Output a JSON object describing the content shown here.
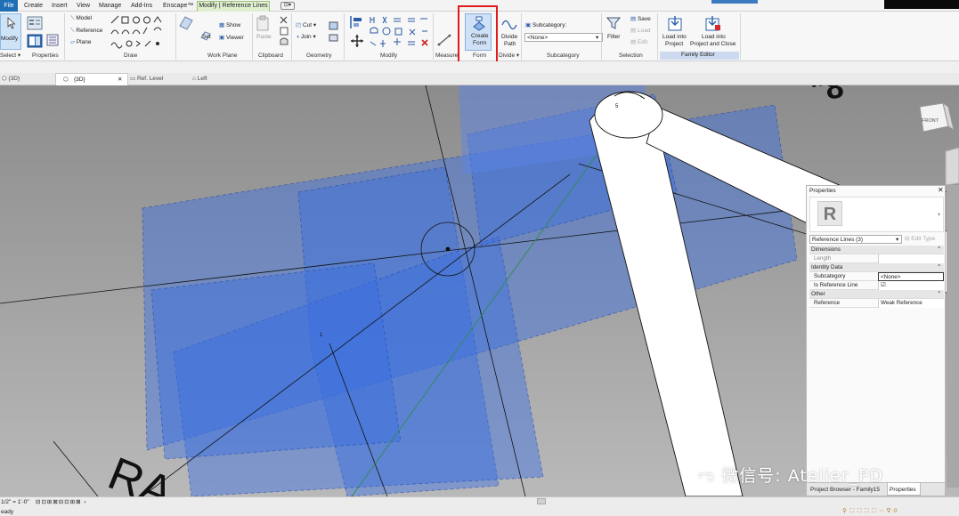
{
  "menubar": {
    "tabs": [
      "File",
      "Create",
      "Insert",
      "View",
      "Manage",
      "Add-Ins",
      "Enscape™",
      "Modify | Reference Lines"
    ]
  },
  "ribbon": {
    "select_label": "Select ▾",
    "properties_label": "Properties",
    "draw_label": "Draw",
    "draw_items": [
      "Model",
      "Reference",
      "Plane"
    ],
    "modify_big": "Modify",
    "workplane_label": "Work Plane",
    "workplane_items": {
      "set": "Set",
      "show": "Show",
      "viewer": "Viewer"
    },
    "clipboard_label": "Clipboard",
    "paste_label": "Paste",
    "geometry_label": "Geometry",
    "geometry_items": {
      "cut": "Cut ▾",
      "join": "Join ▾"
    },
    "modify_label": "Modify",
    "measure_label": "Measure",
    "form_label": "Form",
    "create_form": {
      "line1": "Create",
      "line2": "Form"
    },
    "divide_label": "Divide ▾",
    "divide_path": {
      "line1": "Divide",
      "line2": "Path"
    },
    "subcategory_label": "Subcategory",
    "subcategory_field": "Subcategory:",
    "subcategory_value": "<None>",
    "selection_label": "Selection",
    "filter_label": "Filter",
    "save_items": {
      "save": "Save",
      "load": "Load",
      "edit": "Edit"
    },
    "load_into_project": {
      "line1": "Load into",
      "line2": "Project"
    },
    "load_into_project_close": {
      "line1": "Load into",
      "line2": "Project and Close"
    },
    "family_editor_label": "Family Editor"
  },
  "view_tabs": [
    {
      "label": "{3D}"
    },
    {
      "label": "{3D}",
      "close": "✕"
    },
    {
      "label": "Ref. Level"
    },
    {
      "label": "Left"
    }
  ],
  "viewport": {
    "view_cube_label": "FRONT",
    "ref_number_5": "5",
    "ref_number_1": "1"
  },
  "properties": {
    "title": "Properties",
    "close": "✕",
    "type_selector": "Reference Lines (3)",
    "edit_type": "Edit Type",
    "groups": [
      {
        "name": "Dimensions",
        "rows": [
          {
            "name": "Length",
            "value": ""
          }
        ]
      },
      {
        "name": "Identity Data",
        "rows": [
          {
            "name": "Subcategory",
            "value": "<None>"
          },
          {
            "name": "Is Reference Line",
            "value": "☑"
          }
        ]
      },
      {
        "name": "Other",
        "rows": [
          {
            "name": "Reference",
            "value": "Weak Reference"
          }
        ]
      }
    ],
    "footer_tabs": [
      "Project Browser - Family15",
      "Properties"
    ]
  },
  "status": {
    "scale": "1/2\" = 1'-0\"",
    "ready": "eady"
  },
  "watermark": "微信号: Atelier_PD",
  "colors": {
    "file_tab": "#1f6fb5",
    "contextual_tab": "#e0efd0",
    "highlight_box": "#e01b1b",
    "form_blue": "#4a78e0",
    "viewport_bg": "#999999"
  }
}
